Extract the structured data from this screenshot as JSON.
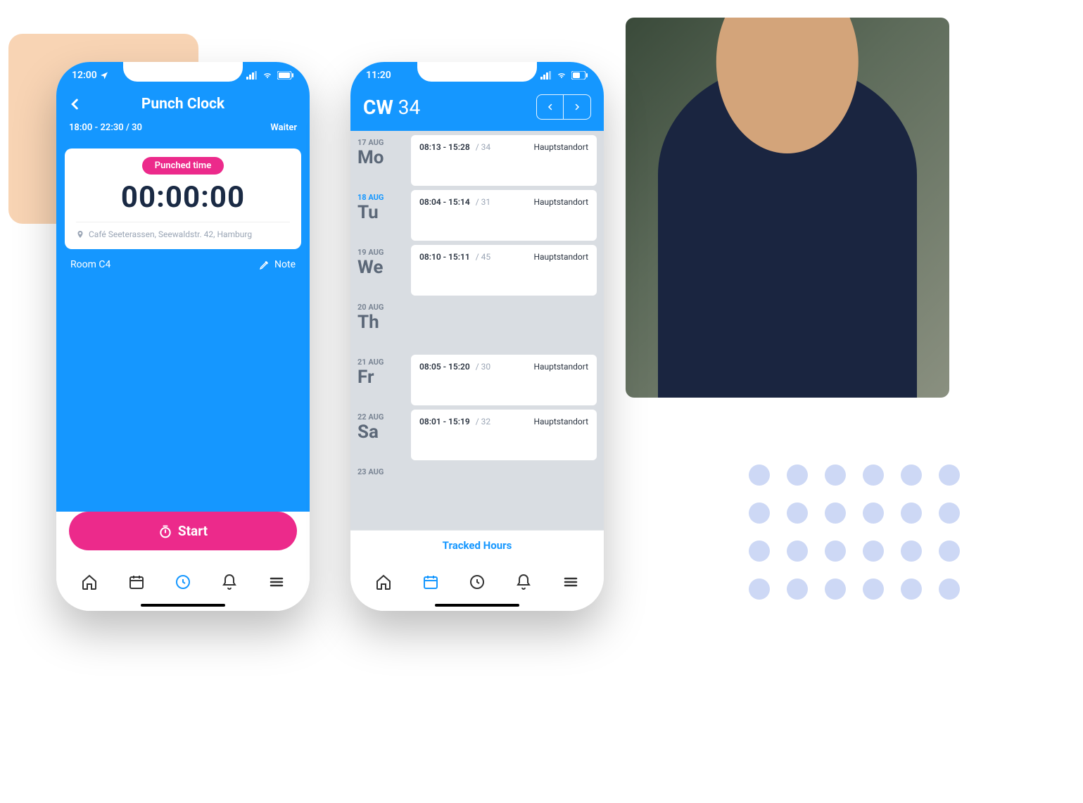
{
  "decoration": {
    "dotCount": 24
  },
  "phone1": {
    "statusbar": {
      "time": "12:00"
    },
    "header": {
      "title": "Punch Clock",
      "shift": "18:00 - 22:30 / 30",
      "role": "Waiter"
    },
    "card": {
      "badge": "Punched time",
      "timer": "00:00:00",
      "address": "Café Seeterassen, Seewaldstr. 42, Hamburg"
    },
    "room": "Room C4",
    "noteLabel": "Note",
    "startLabel": "Start",
    "nav": {
      "activeIndex": 2
    }
  },
  "phone2": {
    "statusbar": {
      "time": "11:20"
    },
    "header": {
      "cwLabel": "CW",
      "cwNum": "34"
    },
    "days": [
      {
        "date": "17 AUG",
        "abbr": "Mo",
        "current": false,
        "range": "08:13 - 15:28",
        "break": "/ 34",
        "loc": "Hauptstandort"
      },
      {
        "date": "18 AUG",
        "abbr": "Tu",
        "current": true,
        "range": "08:04 - 15:14",
        "break": "/ 31",
        "loc": "Hauptstandort"
      },
      {
        "date": "19 AUG",
        "abbr": "We",
        "current": false,
        "range": "08:10 - 15:11",
        "break": "/ 45",
        "loc": "Hauptstandort"
      },
      {
        "date": "20 AUG",
        "abbr": "Th",
        "current": false,
        "range": "",
        "break": "",
        "loc": ""
      },
      {
        "date": "21 AUG",
        "abbr": "Fr",
        "current": false,
        "range": "08:05 - 15:20",
        "break": "/ 30",
        "loc": "Hauptstandort"
      },
      {
        "date": "22 AUG",
        "abbr": "Sa",
        "current": false,
        "range": "08:01 - 15:19",
        "break": "/ 32",
        "loc": "Hauptstandort"
      },
      {
        "date": "23 AUG",
        "abbr": "",
        "current": false,
        "range": "",
        "break": "",
        "loc": ""
      }
    ],
    "trackedLabel": "Tracked Hours",
    "nav": {
      "activeIndex": 1
    }
  }
}
